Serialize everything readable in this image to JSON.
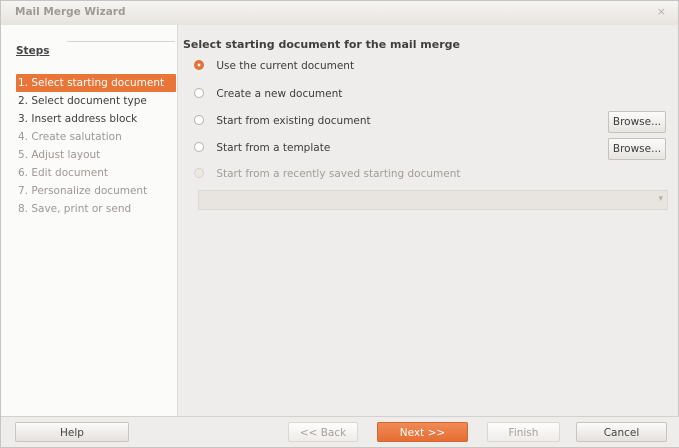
{
  "window": {
    "title": "Mail Merge Wizard",
    "close_icon": "close-icon"
  },
  "steps": {
    "title": "Steps",
    "items": [
      {
        "label": "1. Select starting document",
        "state": "active"
      },
      {
        "label": "2. Select document type",
        "state": "normal"
      },
      {
        "label": "3. Insert address block",
        "state": "normal"
      },
      {
        "label": "4. Create salutation",
        "state": "disabled"
      },
      {
        "label": "5. Adjust layout",
        "state": "disabled"
      },
      {
        "label": "6. Edit document",
        "state": "disabled"
      },
      {
        "label": "7. Personalize document",
        "state": "disabled"
      },
      {
        "label": "8. Save, print or send",
        "state": "disabled"
      }
    ]
  },
  "main": {
    "title": "Select starting document for the mail merge",
    "options": [
      {
        "label": "Use the current document",
        "checked": true,
        "disabled": false
      },
      {
        "label": "Create a new document",
        "checked": false,
        "disabled": false
      },
      {
        "label": "Start from existing document",
        "checked": false,
        "disabled": false
      },
      {
        "label": "Start from a template",
        "checked": false,
        "disabled": false
      },
      {
        "label": "Start from a recently saved starting document",
        "checked": false,
        "disabled": true
      }
    ],
    "browse_label": "Browse...",
    "recent_combo_value": ""
  },
  "footer": {
    "help": "Help",
    "back": "<< Back",
    "next": "Next >>",
    "finish": "Finish",
    "cancel": "Cancel"
  },
  "colors": {
    "accent": "#e77638",
    "selected_step_bg": "#e77638",
    "disabled_text": "#9c9893"
  }
}
